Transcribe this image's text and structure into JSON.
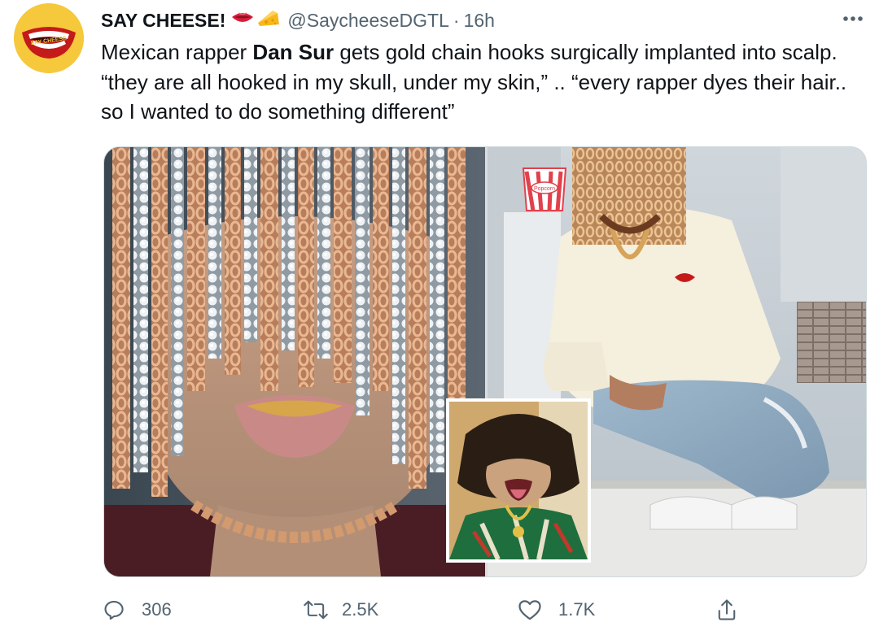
{
  "author": {
    "name": "SAY CHEESE!",
    "handle": "@SaycheeseDGTL",
    "separator": "·",
    "time": "16h",
    "avatar_text": "SAY CHEESE",
    "emoji": [
      "lips-emoji",
      "cheese-emoji"
    ]
  },
  "tweet": {
    "text_before": "Mexican rapper ",
    "text_bold": "Dan Sur",
    "text_after": " gets gold chain hooks surgically implanted into scalp. “they are all hooked in my skull, under my skin,” .. “every rapper dyes their hair.. so I wanted to do something different”"
  },
  "media": {
    "images": [
      "close-up-face-with-chains",
      "crouching-man-in-kitchen",
      "inset-man-sticking-out-tongue"
    ],
    "popcorn_text": "Popcorn"
  },
  "actions": {
    "reply_count": "306",
    "retweet_count": "2.5K",
    "like_count": "1.7K"
  },
  "colors": {
    "text": "#0f1419",
    "secondary": "#536471",
    "border": "#cfd9de",
    "avatar_bg": "#f6c83b"
  }
}
